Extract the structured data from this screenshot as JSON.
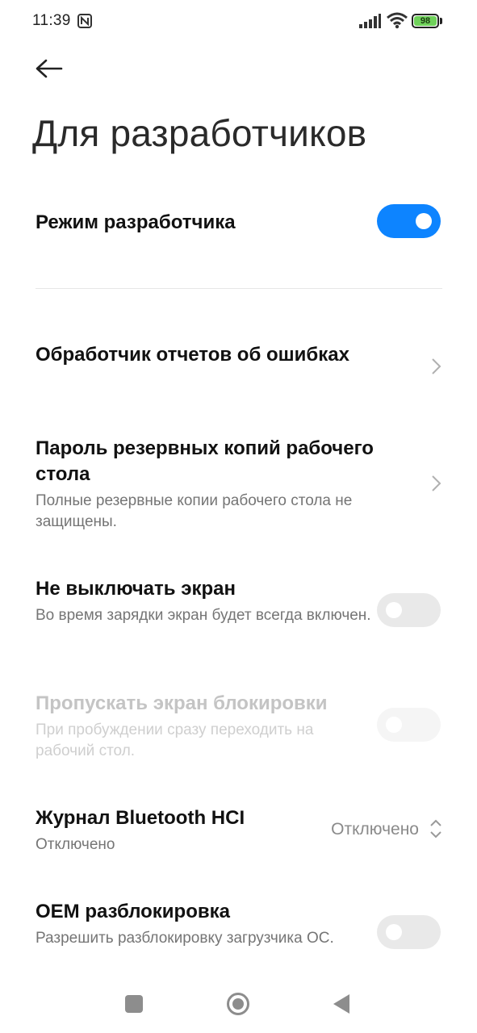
{
  "status_bar": {
    "time": "11:39",
    "battery_level": "98",
    "icons": [
      "nfc-icon",
      "signal-icon",
      "wifi-icon",
      "battery-icon"
    ]
  },
  "header": {
    "back_icon": "arrow-left-icon",
    "title": "Для разработчиков"
  },
  "developer_mode": {
    "label": "Режим разработчика",
    "enabled": true
  },
  "settings": {
    "bug_report": {
      "title": "Обработчик отчетов об ошибках"
    },
    "backup_password": {
      "title": "Пароль резервных копий рабочего стола",
      "subtitle": "Полные резервные копии рабочего стола не защищены."
    },
    "stay_awake": {
      "title": "Не выключать экран",
      "subtitle": "Во время зарядки экран будет всегда включен.",
      "enabled": false
    },
    "skip_lockscreen": {
      "title": "Пропускать экран блокировки",
      "subtitle": "При пробуждении сразу переходить на рабочий стол.",
      "enabled": false,
      "disabled": true
    },
    "bt_hci_log": {
      "title": "Журнал Bluetooth HCI",
      "subtitle": "Отключено",
      "value": "Отключено"
    },
    "oem_unlock": {
      "title": "OEM разблокировка",
      "subtitle": "Разрешить разблокировку загрузчика ОС.",
      "enabled": false
    }
  },
  "nav_bar": {
    "icons": [
      "recents-square-icon",
      "home-circle-icon",
      "back-triangle-icon"
    ]
  },
  "colors": {
    "accent": "#0d84ff",
    "toggle_off": "#e9e9e9",
    "subtitle": "#757575",
    "battery": "#6fd15a"
  }
}
